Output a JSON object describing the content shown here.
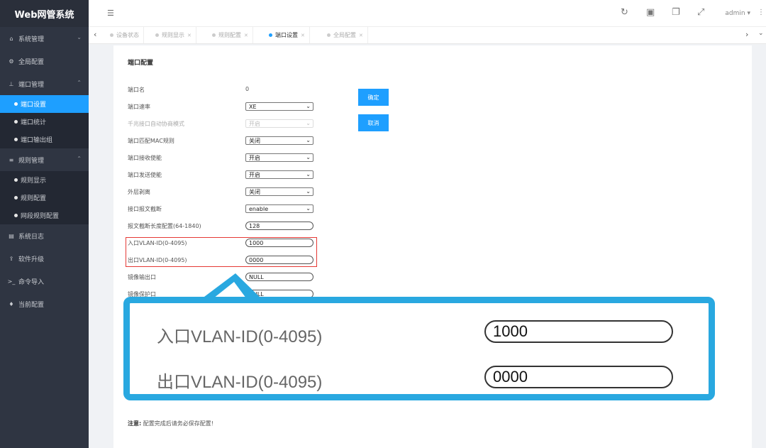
{
  "app": {
    "title": "Web网管系统"
  },
  "sidebar": {
    "groups": [
      {
        "label": "系统管理",
        "icon": "home-icon"
      },
      {
        "label": "全局配置",
        "icon": "gears-icon"
      },
      {
        "label": "端口管理",
        "icon": "sitemap-icon"
      },
      {
        "label": "规则管理",
        "icon": "sliders-icon"
      },
      {
        "label": "系统日志",
        "icon": "file-icon"
      },
      {
        "label": "软件升级",
        "icon": "upload-icon"
      },
      {
        "label": "命令导入",
        "icon": "terminal-icon"
      },
      {
        "label": "当前配置",
        "icon": "map-marker-icon"
      }
    ],
    "port_sub": [
      "端口设置",
      "端口统计",
      "端口输出组"
    ],
    "rule_sub": [
      "规则显示",
      "规则配置",
      "网段规则配置"
    ]
  },
  "header": {
    "user": "admin"
  },
  "tabs": [
    {
      "label": "设备状态"
    },
    {
      "label": "规则显示"
    },
    {
      "label": "规则配置"
    },
    {
      "label": "端口设置"
    },
    {
      "label": "全局配置"
    }
  ],
  "form": {
    "title": "端口配置",
    "port_name": {
      "label": "端口名",
      "value": "0"
    },
    "port_rate": {
      "label": "端口速率",
      "value": "XE"
    },
    "gigabit_auto": {
      "label": "千兆接口自动协商模式",
      "value": "开启"
    },
    "port_mac": {
      "label": "端口匹配MAC规则",
      "value": "关闭"
    },
    "rx_enable": {
      "label": "端口接收使能",
      "value": "开启"
    },
    "tx_enable": {
      "label": "端口发送使能",
      "value": "开启"
    },
    "outer_strip": {
      "label": "外层剥离",
      "value": "关闭"
    },
    "truncate": {
      "label": "接口报文截断",
      "value": "enable"
    },
    "truncate_len": {
      "label": "报文截断长度配置(64-1840)",
      "value": "128"
    },
    "in_vlan": {
      "label": "入口VLAN-ID(0-4095)",
      "value": "1000"
    },
    "out_vlan": {
      "label": "出口VLAN-ID(0-4095)",
      "value": "0000"
    },
    "mirror_out": {
      "label": "镜像输出口",
      "value": "NULL"
    },
    "mirror_protect": {
      "label": "镜像保护口",
      "value": "NULL"
    },
    "confirm": "确定",
    "cancel": "取消",
    "note_bold": "注意:",
    "note_text": " 配置完成后请务必保存配置!"
  },
  "colors": {
    "accent": "#1e9fff",
    "sidebar": "#2f3542",
    "callout": "#29a8e0",
    "highlight": "#e53935"
  }
}
